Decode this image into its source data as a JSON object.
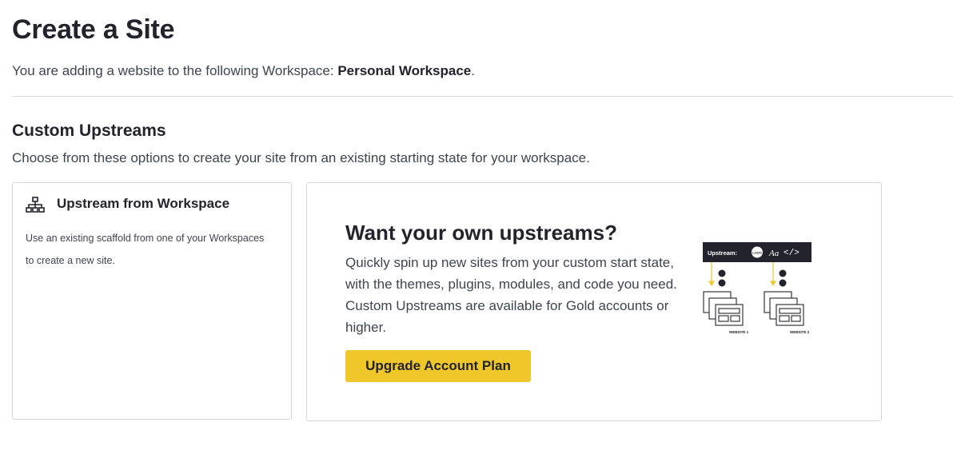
{
  "header": {
    "title": "Create a Site",
    "intro_prefix": "You are adding a website to the following Workspace: ",
    "workspace_name": "Personal Workspace",
    "intro_suffix": "."
  },
  "section": {
    "title": "Custom Upstreams",
    "description": "Choose from these options to create your site from an existing starting state for your workspace."
  },
  "upstream_card": {
    "icon": "sitemap-icon",
    "title": "Upstream from Workspace",
    "description": "Use an existing scaffold from one of your Workspaces to create a new site."
  },
  "promo": {
    "title": "Want your own upstreams?",
    "body": "Quickly spin up new sites from your custom start state, with the themes, plugins, modules, and code you need. Custom Upstreams are available for Gold accounts or higher.",
    "button_label": "Upgrade Account Plan",
    "illustration": {
      "bar_label": "Upstream:",
      "logo_text": "LOGO",
      "font_text": "Aa",
      "code_text": "</>",
      "site1_label": "WEBSITE 1",
      "site2_label": "WEBSITE 2"
    }
  },
  "colors": {
    "accent": "#f0c72b",
    "text": "#23232d",
    "border": "#d5d5dc"
  }
}
